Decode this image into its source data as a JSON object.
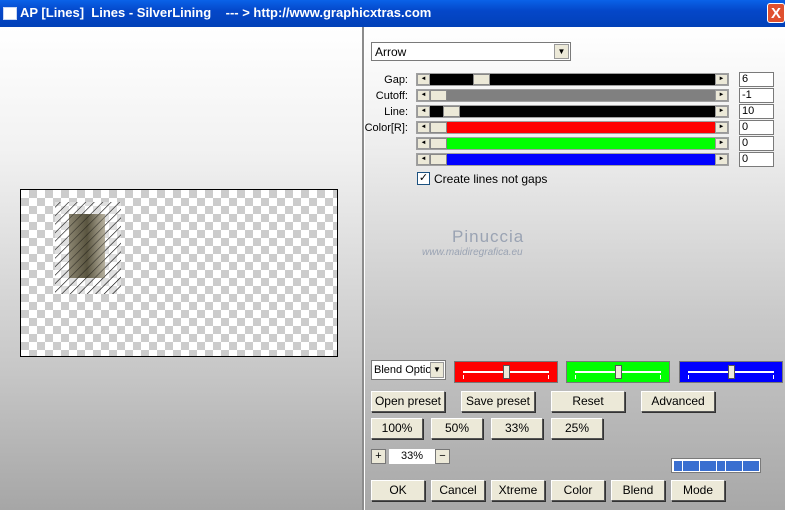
{
  "window": {
    "title": "AP [Lines]  Lines - SilverLining    --- > http://www.graphicxtras.com",
    "close_label": "X"
  },
  "preset_dropdown": {
    "value": "Arrow"
  },
  "sliders": [
    {
      "label": "Gap:",
      "value": "6",
      "track_color": "#000000",
      "level": 0.16
    },
    {
      "label": "Cutoff:",
      "value": "-1",
      "track_color": "#808080",
      "level": 0.0
    },
    {
      "label": "Line:",
      "value": "10",
      "track_color": "#000000",
      "level": 0.05
    },
    {
      "label": "Color[R]:",
      "value": "0",
      "track_color": "#ff0000",
      "level": 0.0
    },
    {
      "label": "",
      "value": "0",
      "track_color": "#00ff00",
      "level": 0.0
    },
    {
      "label": "",
      "value": "0",
      "track_color": "#0000ff",
      "level": 0.0
    }
  ],
  "checkbox": {
    "label": "Create lines not gaps",
    "checked": "✓"
  },
  "watermark": {
    "line1": "Pinuccia",
    "line2": "www.maidiregrafica.eu"
  },
  "blend": {
    "value": "Blend Options"
  },
  "color_boxes": [
    {
      "color": "#ff0000",
      "level": 0.5
    },
    {
      "color": "#00ff00",
      "level": 0.5
    },
    {
      "color": "#0000ff",
      "level": 0.5
    }
  ],
  "buttons": {
    "open_preset": "Open preset",
    "save_preset": "Save preset",
    "reset": "Reset",
    "advanced": "Advanced",
    "z100": "100%",
    "z50": "50%",
    "z33": "33%",
    "z25": "25%",
    "ok": "OK",
    "cancel": "Cancel",
    "xtreme": "Xtreme",
    "color": "Color",
    "blend": "Blend",
    "mode": "Mode"
  },
  "zoom": {
    "value": "33%",
    "plus": "+",
    "minus": "−"
  },
  "progress_cells": 10
}
